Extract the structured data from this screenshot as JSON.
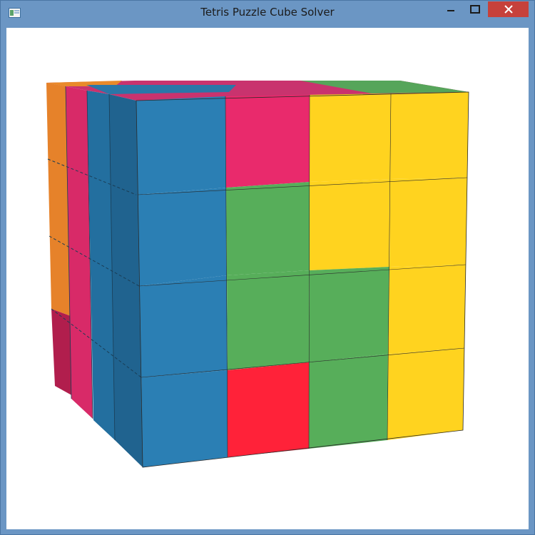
{
  "window": {
    "title": "Tetris Puzzle Cube Solver"
  },
  "icons": {
    "app": "app-window-icon",
    "minimize": "minimize-icon",
    "maximize": "maximize-icon",
    "close": "close-icon"
  },
  "colors": {
    "blue": "#2b7fb4",
    "pink": "#e92a6c",
    "yellow": "#ffd31f",
    "green": "#57ae5a",
    "red": "#ff2239",
    "orange": "#f08c28",
    "close_button": "#c6413b"
  }
}
